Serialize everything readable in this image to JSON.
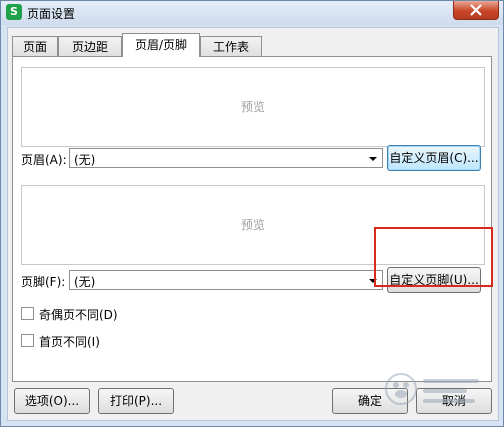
{
  "window": {
    "title": "页面设置"
  },
  "tabs": [
    {
      "label": "页面"
    },
    {
      "label": "页边距"
    },
    {
      "label": "页眉/页脚"
    },
    {
      "label": "工作表"
    }
  ],
  "header": {
    "preview_text": "预览",
    "label": "页眉(A):",
    "value": "(无)",
    "custom_button": "自定义页眉(C)..."
  },
  "footer": {
    "preview_text": "预览",
    "label": "页脚(F):",
    "value": "(无)",
    "custom_button": "自定义页脚(U)..."
  },
  "options": {
    "odd_even": "奇偶页不同(D)",
    "first_page": "首页不同(I)"
  },
  "buttons": {
    "options": "选项(O)...",
    "print": "打印(P)...",
    "ok": "确定",
    "cancel": "取消"
  },
  "colors": {
    "highlight": "#d62a1e"
  }
}
